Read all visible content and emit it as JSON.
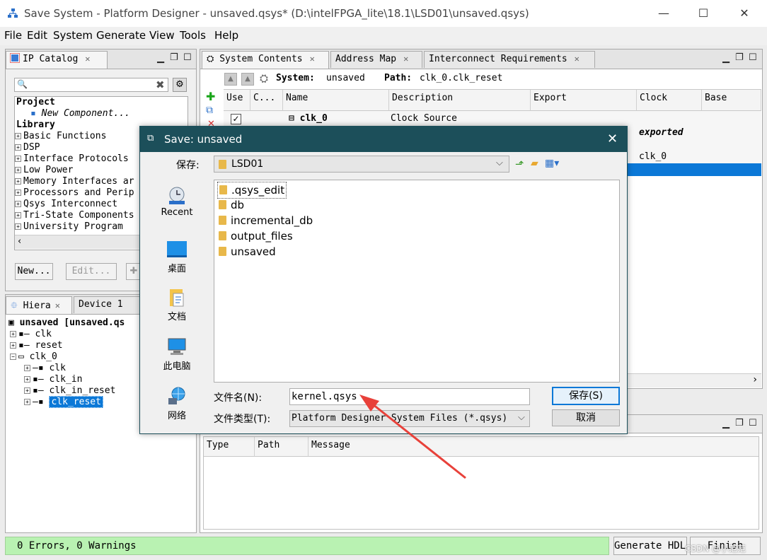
{
  "window": {
    "title": "Save System - Platform Designer - unsaved.qsys* (D:\\intelFPGA_lite\\18.1\\LSD01\\unsaved.qsys)",
    "controls": {
      "minimize": "—",
      "maximize": "☐",
      "close": "✕"
    }
  },
  "menu": [
    "File",
    "Edit",
    "System",
    "Generate",
    "View",
    "Tools",
    "Help"
  ],
  "ip_catalog": {
    "tab": "IP Catalog",
    "search_placeholder": "",
    "project_label": "Project",
    "new_component": "New Component...",
    "library_label": "Library",
    "library_items": [
      "Basic Functions",
      "DSP",
      "Interface Protocols",
      "Low Power",
      "Memory Interfaces ar",
      "Processors and Perip",
      "Qsys Interconnect",
      "Tri-State Components",
      "University Program"
    ],
    "buttons": {
      "new": "New...",
      "edit": "Edit..."
    }
  },
  "hierarchy": {
    "tabs": [
      "Hiera",
      "Device 1"
    ],
    "root": "unsaved [unsaved.qs",
    "items": [
      "clk",
      "reset",
      "clk_0",
      "clk",
      "clk_in",
      "clk_in_reset",
      "clk_reset"
    ],
    "selected": "clk_reset"
  },
  "system_contents": {
    "tabs": [
      "System Contents",
      "Address Map",
      "Interconnect Requirements"
    ],
    "system_label": "System:",
    "system_value": "unsaved",
    "path_label": "Path:",
    "path_value": "clk_0.clk_reset",
    "columns": [
      "Use",
      "C...",
      "Name",
      "Description",
      "Export",
      "Clock",
      "Base"
    ],
    "row": {
      "name": "clk_0",
      "description": "Clock Source",
      "clock_exported": "exported",
      "clock_value": "clk_0"
    }
  },
  "messages": {
    "columns": [
      "Type",
      "Path",
      "Message"
    ]
  },
  "dialog": {
    "title": "Save: unsaved",
    "save_in_label": "保存:",
    "save_in_value": "LSD01",
    "places": [
      "Recent",
      "桌面",
      "文档",
      "此电脑",
      "网络"
    ],
    "files": [
      ".qsys_edit",
      "db",
      "incremental_db",
      "output_files",
      "unsaved"
    ],
    "filename_label": "文件名(N):",
    "filename_value": "kernel.qsys",
    "filetype_label": "文件类型(T):",
    "filetype_value": "Platform Designer System Files (*.qsys)",
    "save_button": "保存(S)",
    "cancel_button": "取消"
  },
  "status": {
    "text": "0 Errors, 0 Warnings",
    "generate_button": "Generate HDL...",
    "finish_button": "Finish"
  },
  "watermark": "CSDN @小范范",
  "colors": {
    "dialog_title": "#1c4f5a",
    "selection": "#0b78d7",
    "status_ok": "#b9f2b2",
    "arrow": "#e8413a"
  }
}
